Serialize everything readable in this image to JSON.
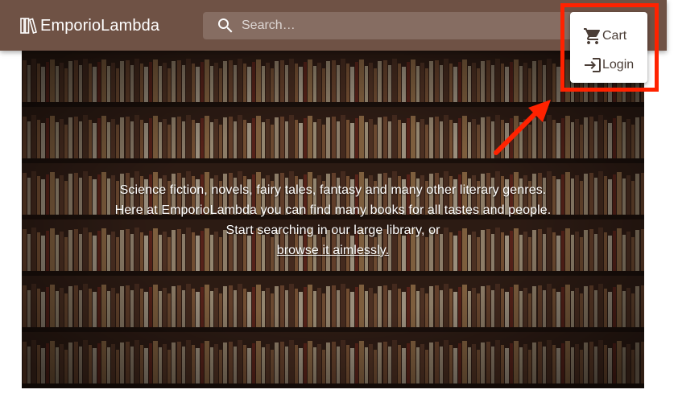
{
  "app": {
    "title": "EmporioLambda",
    "logo_icon": "library-books-icon"
  },
  "search": {
    "placeholder": "Search…",
    "icon": "search-icon"
  },
  "menu": {
    "items": [
      {
        "label": "Cart",
        "icon": "shopping-cart-icon"
      },
      {
        "label": "Login",
        "icon": "login-icon"
      }
    ]
  },
  "hero": {
    "lines": [
      "Science fiction, novels, fairy tales, fantasy and many other literary genres.",
      "Here at EmporioLambda you can find many books for all tastes and people.",
      "Start searching in our large library, or"
    ],
    "link_text": "browse it aimlessly."
  },
  "colors": {
    "app_bar": "#6f5245",
    "annotation": "#ff2200"
  }
}
